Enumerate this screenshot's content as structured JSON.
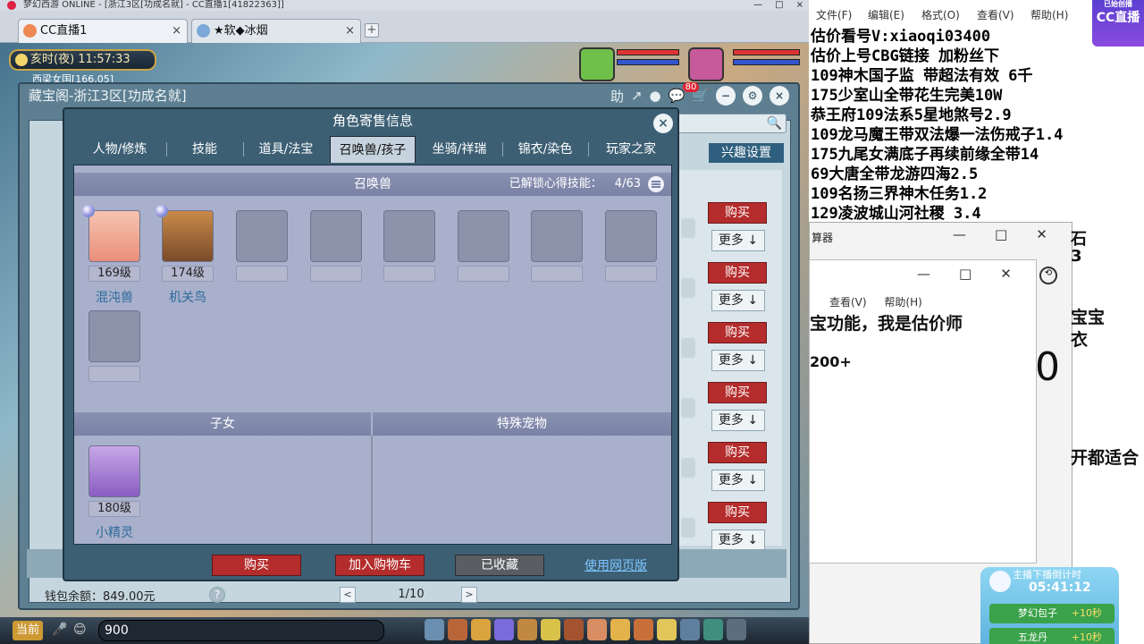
{
  "game_window": {
    "title_bar": "梦幻西游 ONLINE - [浙江3区[功成名就] - CC直播1[41822363]]",
    "tabs": [
      {
        "label": "CC直播1",
        "close": "×"
      },
      {
        "label": "★软◆冰烟",
        "close": "×"
      }
    ],
    "new_tab": "+",
    "clock": "亥时(夜) 11:57:33",
    "location": "西梁女国[166,05]",
    "main_title": "藏宝阁-浙江3区[功成名就]",
    "main_buttons": {
      "help": "助",
      "cart_badge": "80"
    },
    "interest_button": "兴趣设置",
    "buy_label": "购买",
    "more_label": "更多 ↓",
    "wallet": "钱包余额：849.00元",
    "help_q": "?",
    "pager": {
      "prev": "<",
      "text": "1/10",
      "next": ">"
    }
  },
  "modal": {
    "title": "角色寄售信息",
    "close": "×",
    "tabs": [
      "人物/修炼",
      "技能",
      "道具/法宝",
      "召唤兽/孩子",
      "坐骑/祥瑞",
      "锦衣/染色",
      "玩家之家"
    ],
    "active_tab": "召唤兽/孩子",
    "summon_section": {
      "title": "召唤兽",
      "locks": "已解锁心得技能：",
      "locks_value": "4/63",
      "pets": [
        {
          "level": "169级",
          "name": "混沌兽"
        },
        {
          "level": "174级",
          "name": "机关鸟"
        }
      ]
    },
    "children_section": {
      "title": "子女",
      "children": [
        {
          "level": "180级",
          "name": "小精灵"
        }
      ]
    },
    "special_section": {
      "title": "特殊宠物"
    },
    "footer": {
      "buy": "购买",
      "add_cart": "加入购物车",
      "favorited": "已收藏",
      "web": "使用网页版"
    }
  },
  "taskbar": {
    "current": "当前",
    "input": "900"
  },
  "notepad": {
    "menu": [
      "文件(F)",
      "编辑(E)",
      "格式(O)",
      "查看(V)",
      "帮助(H)"
    ],
    "lines": [
      "估价看号V:xiaoqi03400",
      "估价上号CBG链接 加粉丝下",
      "109神木国子监 带超法有效 6千",
      "175少室山全带花生完美10W",
      "恭王府109法系5星地煞号2.9",
      "109龙马魔王带双法爆一法伤戒子1.4",
      "175九尾女满底子再续前缘全带14",
      "69大唐全带龙游四海2.5",
      "109名扬三界神木任务1.2",
      "129凌波城山河社稷  3.4"
    ]
  },
  "cc_logo": {
    "label": "CC直播",
    "top": "已始创播"
  },
  "calculator": {
    "title": "算器",
    "inner_menu": [
      "查看(V)",
      "帮助(H)"
    ],
    "text1": "宝功能，我是估价师",
    "text2": "200+",
    "display": "0",
    "side_1": "宝宝",
    "side_2": "衣",
    "side_3": "开都适合",
    "side_top": "石",
    "side_top2": "3"
  },
  "timer": {
    "head": "主播下播倒计时",
    "time": "05:41:12",
    "rows": [
      {
        "label": "梦幻包子",
        "bonus": "+10秒"
      },
      {
        "label": "五龙丹",
        "bonus": "+10秒"
      }
    ]
  }
}
